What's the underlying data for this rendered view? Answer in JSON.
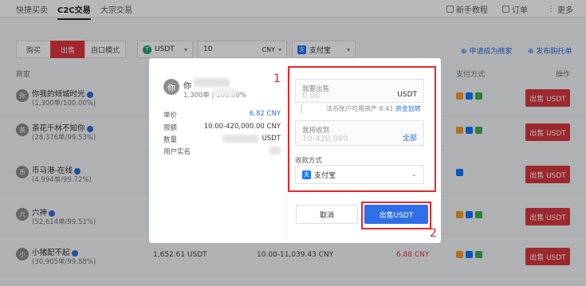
{
  "nav": {
    "tabs": [
      "快捷买卖",
      "C2C交易",
      "大宗交易"
    ],
    "right": [
      "新手教程",
      "订单",
      "更多"
    ]
  },
  "filters": {
    "buy": "购买",
    "sell": "出售",
    "mode": "自口模式",
    "coin": "USDT",
    "amount": "10",
    "currency": "CNY",
    "payment": "支付宝",
    "apply_merchant": "申请成为商家",
    "post_ad": "发布购托单"
  },
  "table": {
    "headers": {
      "merchant": "商家",
      "payment": "支付方式",
      "action": "操作"
    },
    "rows": [
      {
        "avatar": "你",
        "name": "你我的倾城时光",
        "stats": "(1,300单/100.00%)",
        "action": "出售 USDT"
      },
      {
        "avatar": "茶",
        "name": "茶花千林不知你",
        "stats": "(28,376单/99.53%)",
        "action": "出售 USDT"
      },
      {
        "avatar": "币",
        "name": "币马港-在线",
        "stats": "(4,994单/99.72%)",
        "action": "出售 USDT"
      },
      {
        "avatar": "六",
        "name": "六神",
        "stats": "(52,614单/99.51%)",
        "action": "出售 USDT"
      },
      {
        "avatar": "小",
        "name": "小猪配不起",
        "stats": "(30,905单/99.88%)",
        "action": "出售 USDT",
        "available": "1,652.61 USDT",
        "limit": "10.00-11,039.43 CNY",
        "price": "6.88 CNY"
      }
    ]
  },
  "modal": {
    "avatar": "你",
    "name_prefix": "你",
    "stats": "1,300单 | 100.00%",
    "unit_price_label": "单价",
    "unit_price_value": "6.82 CNY",
    "limit_label": "限额",
    "limit_value": "10.00-420,000.00 CNY",
    "quantity_label": "数量",
    "quantity_unit": "USDT",
    "realname_label": "用户实名",
    "sell_label": "我要出售",
    "sell_placeholder": "0.00",
    "sell_unit": "USDT",
    "note_text": "法币账户可用资产 8.41",
    "note_link": "资金划转",
    "receive_label": "我将收到",
    "receive_placeholder": "10-420,000",
    "receive_all": "全部",
    "method_label": "收款方式",
    "method_value": "支付宝",
    "cancel": "取消",
    "confirm": "出售USDT",
    "marker_1": "1",
    "marker_2": "2"
  }
}
